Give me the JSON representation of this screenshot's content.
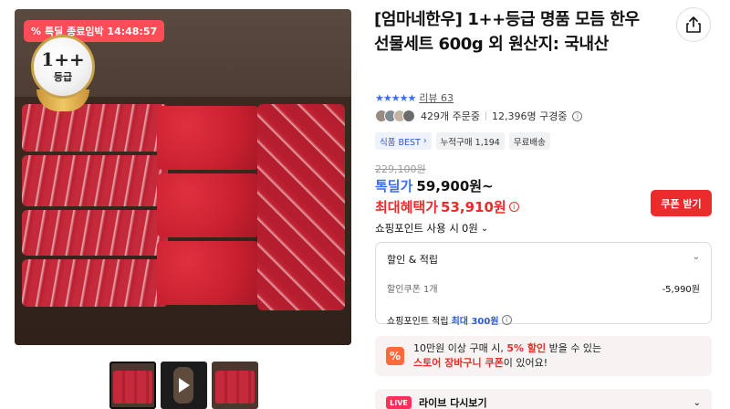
{
  "gallery": {
    "timer_badge": "특딜 종료임박 14:48:57",
    "grade_title": "1++",
    "grade_sub": "등급",
    "thumbnails": [
      "thumb-meat",
      "thumb-video",
      "thumb-meat-2"
    ]
  },
  "product": {
    "title": "[엄마네한우] 1++등급 명품 모듬 한우 선물세트 600g 외 원산지: 국내산",
    "rating_stars": "★★★★★",
    "rating_value": 5,
    "review_label": "리뷰 63",
    "orders": "429개 주문중",
    "subscribers": "12,396명 구경중",
    "tags": [
      "식품 BEST",
      "누적구매 1,194",
      "무료배송"
    ]
  },
  "price": {
    "original": "229,100원",
    "deal_label": "톡딜가",
    "deal_value": "59,900원~",
    "max_label": "최대혜택가",
    "max_value": "53,910원",
    "coupon_button": "쿠폰 받기",
    "points_usage": "쇼핑포인트 사용 시",
    "points_usage_value": "0원"
  },
  "discount": {
    "header": "할인 & 적립",
    "coupon_label": "할인쿠폰 1개",
    "coupon_amount": "-5,990원",
    "points_label": "쇼핑포인트 적립",
    "points_max": "최대 300원"
  },
  "promo": {
    "line1_pre": "10만원 이상 구매 시,",
    "line1_highlight": "5% 할인",
    "line1_post": "받을 수 있는",
    "line2_highlight": "스토어 장바구니 쿠폰",
    "line2_post": "이 있어요!"
  },
  "live": {
    "badge": "LIVE",
    "label": "라이브 다시보기"
  },
  "colors": {
    "accent_blue": "#3b6df0",
    "accent_red": "#ee2b2b",
    "coupon_button": "#ec2c2c",
    "timer_badge": "#ff4d57"
  },
  "icons": [
    "share-icon",
    "info-icon",
    "chevron-down-icon",
    "chevron-right-icon",
    "play-icon",
    "percent-icon"
  ]
}
